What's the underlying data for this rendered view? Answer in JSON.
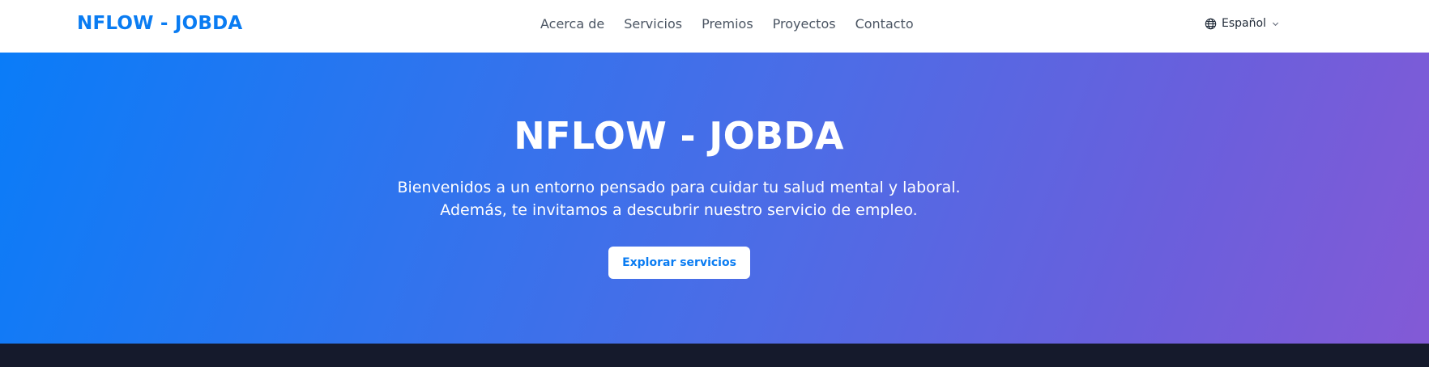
{
  "header": {
    "brand": "NFLOW - JOBDA",
    "nav": [
      {
        "label": "Acerca de"
      },
      {
        "label": "Servicios"
      },
      {
        "label": "Premios"
      },
      {
        "label": "Proyectos"
      },
      {
        "label": "Contacto"
      }
    ],
    "language": {
      "label": "Español",
      "icon": "globe-icon",
      "caret": "chevron-down-icon"
    }
  },
  "hero": {
    "title": "NFLOW - JOBDA",
    "subtitle": "Bienvenidos a un entorno pensado para cuidar tu salud mental y laboral. Además, te invitamos a descubrir nuestro servicio de empleo.",
    "cta": "Explorar servicios"
  },
  "colors": {
    "brand": "#0a7cf2",
    "hero_gradient_start": "#0a7cf8",
    "hero_gradient_end": "#835ad6",
    "footer_band": "#151a2c"
  }
}
